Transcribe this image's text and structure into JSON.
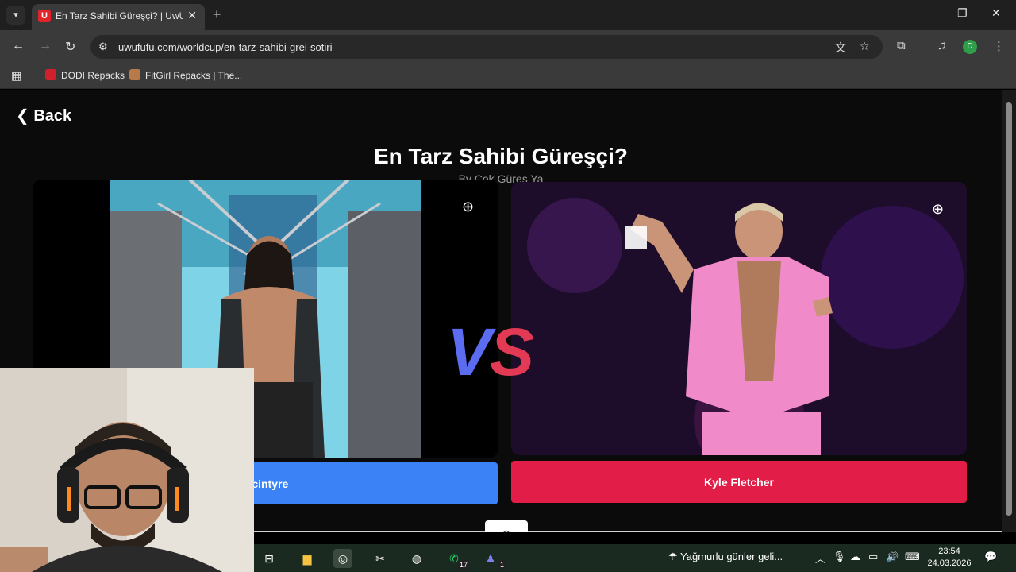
{
  "browser": {
    "tab_title": "En Tarz Sahibi Güreşçi? | UwUFUFU",
    "tab_favicon_letter": "U",
    "url": "uwufufu.com/worldcup/en-tarz-sahibi-grei-sotiri",
    "profile_initial": "D",
    "bookmarks": [
      {
        "label": "DODI Repacks",
        "icon": "dodi-icon",
        "color": "#d11f2b"
      },
      {
        "label": "FitGirl Repacks | The...",
        "icon": "fitgirl-icon",
        "color": "#b77a4a"
      }
    ]
  },
  "page": {
    "back_label": "Back",
    "title": "En Tarz Sahibi Güreşçi?",
    "author": "By Çok Güres Ya",
    "vs_v": "V",
    "vs_s": "S",
    "left_choice": "Mcintyre",
    "right_choice": "Kyle Fletcher",
    "colors": {
      "left_button": "#3b82f6",
      "right_button": "#e11d48",
      "background": "#0b0b0b"
    }
  },
  "taskbar": {
    "weather_text": "Yağmurlu günler geli...",
    "time": "23:54",
    "date": "24.03.2026",
    "whatsapp_badge": "17",
    "teams_badge": "1"
  }
}
